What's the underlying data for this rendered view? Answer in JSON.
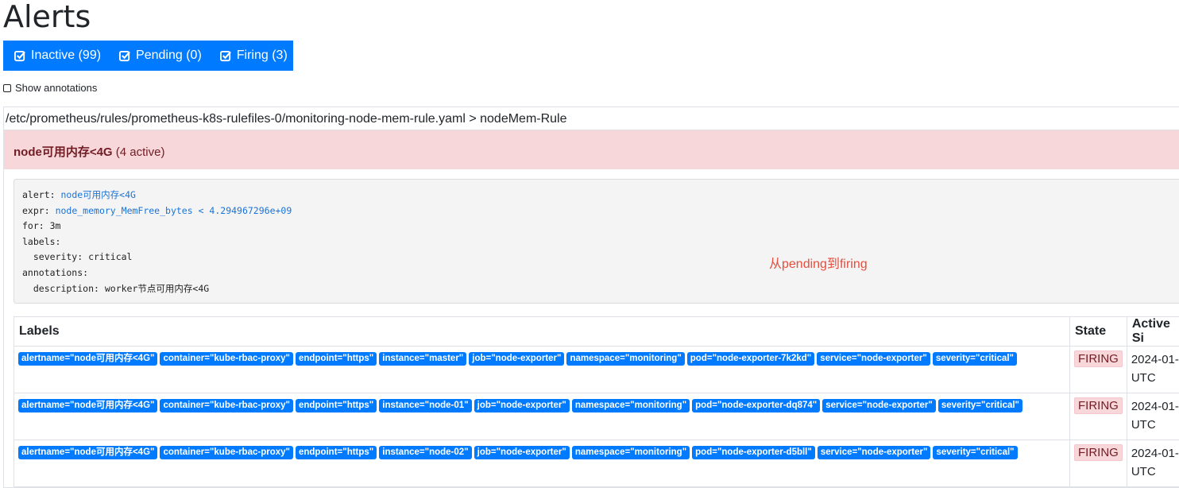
{
  "page": {
    "title": "Alerts"
  },
  "filters": [
    {
      "label": "Inactive (99)",
      "icon": "checkbox-checked-icon"
    },
    {
      "label": "Pending (0)",
      "icon": "checkbox-checked-icon"
    },
    {
      "label": "Firing (3)",
      "icon": "checkbox-checked-icon"
    }
  ],
  "show_annotations": {
    "label": "Show annotations",
    "checked": false
  },
  "group": {
    "path": "/etc/prometheus/rules/prometheus-k8s-rulefiles-0/monitoring-node-mem-rule.yaml > nodeMem-Rule"
  },
  "rule": {
    "name": "node可用内存<4G",
    "active_count": "(4 active)",
    "definition": {
      "alert_key": "alert:",
      "alert_val": "node可用内存<4G",
      "expr_key": "expr:",
      "expr_val": "node_memory_MemFree_bytes < 4.294967296e+09",
      "for_line": "for: 3m",
      "labels_line": "labels:",
      "severity_line": "  severity: critical",
      "annotations_line": "annotations:",
      "description_line": "  description: worker节点可用内存<4G"
    }
  },
  "annotation_note": "从pending到firing",
  "table": {
    "headers": {
      "labels": "Labels",
      "state": "State",
      "active_since": "Active Si"
    },
    "rows": [
      {
        "labels": [
          "alertname=\"node可用内存<4G\"",
          "container=\"kube-rbac-proxy\"",
          "endpoint=\"https\"",
          "instance=\"master\"",
          "job=\"node-exporter\"",
          "namespace=\"monitoring\"",
          "pod=\"node-exporter-7k2kd\"",
          "service=\"node-exporter\"",
          "severity=\"critical\""
        ],
        "state": "FIRING",
        "active_since_1": "2024-01-",
        "active_since_2": "UTC"
      },
      {
        "labels": [
          "alertname=\"node可用内存<4G\"",
          "container=\"kube-rbac-proxy\"",
          "endpoint=\"https\"",
          "instance=\"node-01\"",
          "job=\"node-exporter\"",
          "namespace=\"monitoring\"",
          "pod=\"node-exporter-dq874\"",
          "service=\"node-exporter\"",
          "severity=\"critical\""
        ],
        "state": "FIRING",
        "active_since_1": "2024-01-",
        "active_since_2": "UTC"
      },
      {
        "labels": [
          "alertname=\"node可用内存<4G\"",
          "container=\"kube-rbac-proxy\"",
          "endpoint=\"https\"",
          "instance=\"node-02\"",
          "job=\"node-exporter\"",
          "namespace=\"monitoring\"",
          "pod=\"node-exporter-d5bll\"",
          "service=\"node-exporter\"",
          "severity=\"critical\""
        ],
        "state": "FIRING",
        "active_since_1": "2024-01-",
        "active_since_2": "UTC"
      }
    ]
  },
  "colors": {
    "primary": "#007bff",
    "firing_bg": "#f8d7da",
    "firing_text": "#721c24",
    "annotation_red": "#e74c3c"
  }
}
